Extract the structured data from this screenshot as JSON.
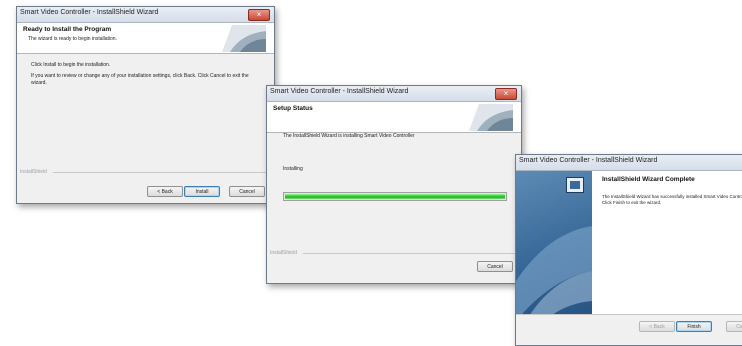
{
  "windows": [
    {
      "title": "Smart Video Controller - InstallShield Wizard",
      "close_glyph": "×",
      "header": {
        "title": "Ready to Install the Program",
        "subtitle": "The wizard is ready to begin installation."
      },
      "body": [
        "Click Install to begin the installation.",
        "If you want to review or change any of your installation settings, click Back. Click Cancel to exit the wizard."
      ],
      "brand": "InstallShield",
      "buttons": {
        "back": "< Back",
        "install": "Install",
        "cancel": "Cancel"
      }
    },
    {
      "title": "Smart Video Controller - InstallShield Wizard",
      "close_glyph": "×",
      "header": {
        "title": "Setup Status"
      },
      "body": [
        "The InstallShield Wizard is installing Smart Video Controller",
        "Installing"
      ],
      "progress": 1.0,
      "progress_color": "#34c634",
      "brand": "InstallShield",
      "buttons": {
        "cancel": "Cancel"
      }
    },
    {
      "title": "Smart Video Controller - InstallShield Wizard",
      "heading": "InstallShield Wizard Complete",
      "body": "The InstallShield Wizard has successfully installed Smart Video Controller. Click Finish to exit the wizard.",
      "buttons": {
        "back": "< Back",
        "finish": "Finish",
        "cancel": "Cancel"
      }
    }
  ]
}
